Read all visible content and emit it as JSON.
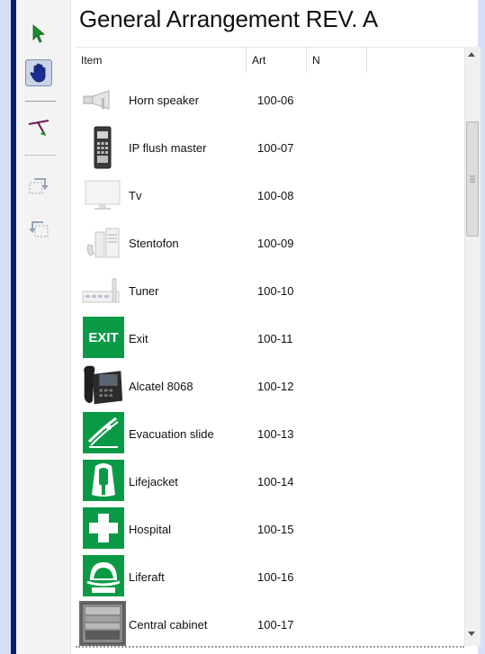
{
  "window": {
    "title": "General Arrangement REV. A"
  },
  "toolbar": {
    "items": [
      {
        "name": "select-arrow-icon"
      },
      {
        "name": "pan-hand-icon"
      },
      {
        "name": "connect-tool-icon"
      },
      {
        "name": "rotate-right-icon"
      },
      {
        "name": "rotate-left-icon"
      }
    ]
  },
  "table": {
    "columns": [
      "Item",
      "Art",
      "N"
    ],
    "rows": [
      {
        "item": "Horn speaker",
        "art": "100-06",
        "icon": "horn-speaker-icon"
      },
      {
        "item": "IP flush master",
        "art": "100-07",
        "icon": "ip-flush-master-icon"
      },
      {
        "item": "Tv",
        "art": "100-08",
        "icon": "tv-icon"
      },
      {
        "item": "Stentofon",
        "art": "100-09",
        "icon": "stentofon-icon"
      },
      {
        "item": "Tuner",
        "art": "100-10",
        "icon": "tuner-icon"
      },
      {
        "item": "Exit",
        "art": "100-11",
        "icon": "exit-sign-icon"
      },
      {
        "item": "Alcatel 8068",
        "art": "100-12",
        "icon": "desk-phone-icon"
      },
      {
        "item": "Evacuation slide",
        "art": "100-13",
        "icon": "evacuation-slide-icon"
      },
      {
        "item": "Lifejacket",
        "art": "100-14",
        "icon": "lifejacket-icon"
      },
      {
        "item": "Hospital",
        "art": "100-15",
        "icon": "hospital-cross-icon"
      },
      {
        "item": "Liferaft",
        "art": "100-16",
        "icon": "liferaft-icon"
      },
      {
        "item": "Central cabinet",
        "art": "100-17",
        "icon": "central-cabinet-icon"
      }
    ]
  },
  "exit_label": "EXIT",
  "colors": {
    "frame": "#0b1e6e",
    "safety_green": "#0a9a46",
    "arrow_green": "#1a8a2a"
  }
}
